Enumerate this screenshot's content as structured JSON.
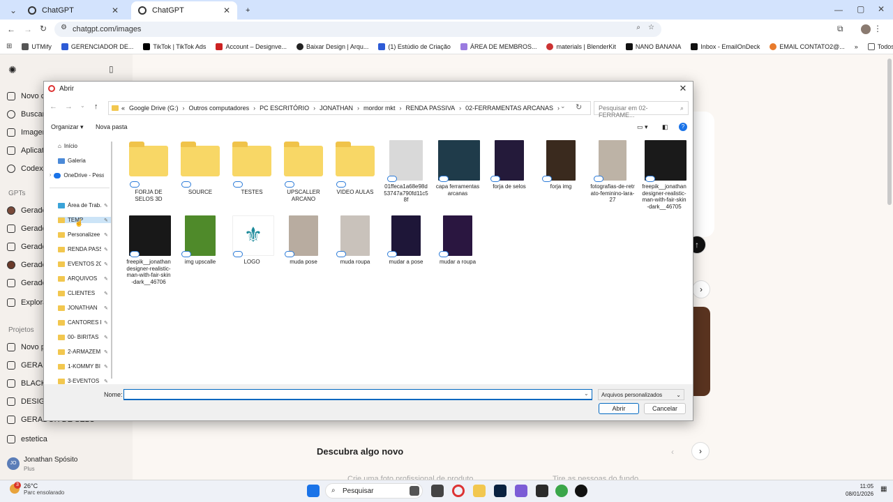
{
  "browser": {
    "tabs": [
      {
        "label": "ChatGPT",
        "active": false
      },
      {
        "label": "ChatGPT",
        "active": true
      }
    ],
    "new_tab_label": "+",
    "url": "chatgpt.com/images",
    "bookmarks": [
      "UTMify",
      "GERENCIADOR DE...",
      "TikTok | TikTok Ads",
      "Account – Designve...",
      "Baixar Design | Arqu...",
      "(1) Estúdio de Criação",
      "ÁREA DE MEMBROS...",
      "materials | BlenderKit",
      "NANO BANANA",
      "Inbox - EmailOnDeck",
      "EMAIL CONTATO2@..."
    ],
    "all_bookmarks_label": "Todos os favoritos"
  },
  "sidebar": {
    "items_top": [
      "Novo c",
      "Buscar",
      "Imagen",
      "Aplicat",
      "Codex"
    ],
    "gpts_heading": "GPTs",
    "gpts": [
      "Gerado",
      "Gerado",
      "Gerado",
      "Gerado",
      "Gerado",
      "Explora"
    ],
    "projects_heading": "Projetos",
    "projects": [
      "Novo p",
      "GERAD",
      "BLACK",
      "DESIGN",
      "GERADOR DE SELO",
      "estetica"
    ],
    "user_name": "Jonathan Spósito",
    "user_plan": "Plus",
    "user_initials": "JO"
  },
  "page": {
    "discover_title": "Descubra algo novo",
    "card1": "Crie uma foto profissional de produto",
    "card2": "Tire as pessoas do fundo"
  },
  "dialog": {
    "title": "Abrir",
    "path": [
      "Google Drive (G:)",
      "Outros computadores",
      "PC ESCRITÓRIO",
      "JONATHAN",
      "mordor mkt",
      "RENDA PASSIVA",
      "02-FERRAMENTAS ARCANAS"
    ],
    "path_prefix": "«",
    "search_placeholder": "Pesquisar em 02-FERRAME...",
    "organize_label": "Organizar ▾",
    "new_folder_label": "Nova pasta",
    "nav_items": [
      {
        "label": "Início",
        "type": "home"
      },
      {
        "label": "Galeria",
        "type": "gallery"
      },
      {
        "label": "OneDrive - Pesso",
        "type": "cloud"
      },
      {
        "label": "Área de Trab.",
        "type": "desktop"
      },
      {
        "label": "TEMP",
        "type": "folder"
      },
      {
        "label": "Personalizee",
        "type": "folder"
      },
      {
        "label": "RENDA PASS",
        "type": "folder"
      },
      {
        "label": "EVENTOS 202",
        "type": "folder"
      },
      {
        "label": "ARQUIVOS",
        "type": "folder"
      },
      {
        "label": "CLIENTES",
        "type": "folder"
      },
      {
        "label": "JONATHAN",
        "type": "folder"
      },
      {
        "label": "CANTORES P",
        "type": "folder"
      },
      {
        "label": "00- BIRITAS",
        "type": "folder"
      },
      {
        "label": "2-ARMAZEM",
        "type": "folder"
      },
      {
        "label": "1-KOMMY BI",
        "type": "folder"
      },
      {
        "label": "3-EVENTOS",
        "type": "folder"
      }
    ],
    "files_row1": [
      {
        "name": "FORJA DE SELOS 3D",
        "kind": "folder"
      },
      {
        "name": "SOURCE",
        "kind": "folder"
      },
      {
        "name": "TESTES",
        "kind": "folder"
      },
      {
        "name": "UPSCALLER ARCANO",
        "kind": "folder"
      },
      {
        "name": "VIDEO AULAS",
        "kind": "folder"
      },
      {
        "name": "01ffeca1a68e98d53747a790fd11c58f",
        "kind": "image",
        "color": "#d9d9d9"
      },
      {
        "name": "capa ferramentas arcanas",
        "kind": "image",
        "color": "#1f3b4a"
      },
      {
        "name": "forja de selos",
        "kind": "image",
        "color": "#241a3a"
      },
      {
        "name": "forja img",
        "kind": "image",
        "color": "#3a2a1e"
      },
      {
        "name": "fotografias-de-retrato-feminino-lara-27",
        "kind": "image",
        "color": "#bdb3a6"
      },
      {
        "name": "freepik__jonathandesigner-realistic-man-with-fair-skin-dark__46705",
        "kind": "image",
        "color": "#1a1a1a"
      }
    ],
    "files_row2": [
      {
        "name": "freepik__jonathandesigner-realistic-man-with-fair-skin-dark__46706",
        "kind": "image",
        "color": "#181818"
      },
      {
        "name": "img upscalle",
        "kind": "image",
        "color": "#4f8a2a"
      },
      {
        "name": "LOGO",
        "kind": "image",
        "color": "#ffffff"
      },
      {
        "name": "muda pose",
        "kind": "image",
        "color": "#b8aca0"
      },
      {
        "name": "muda roupa",
        "kind": "image",
        "color": "#c9c2bb"
      },
      {
        "name": "mudar a pose",
        "kind": "image",
        "color": "#1e1638"
      },
      {
        "name": "mudar a roupa",
        "kind": "image",
        "color": "#2a1640"
      }
    ],
    "name_label": "Nome:",
    "name_value": "",
    "file_type": "Arquivos personalizados",
    "open_label": "Abrir",
    "cancel_label": "Cancelar"
  },
  "taskbar": {
    "weather_temp": "26°C",
    "weather_desc": "Parc ensolarado",
    "weather_badge": "3",
    "search_label": "Pesquisar",
    "time": "11:05",
    "date": "08/01/2026"
  }
}
